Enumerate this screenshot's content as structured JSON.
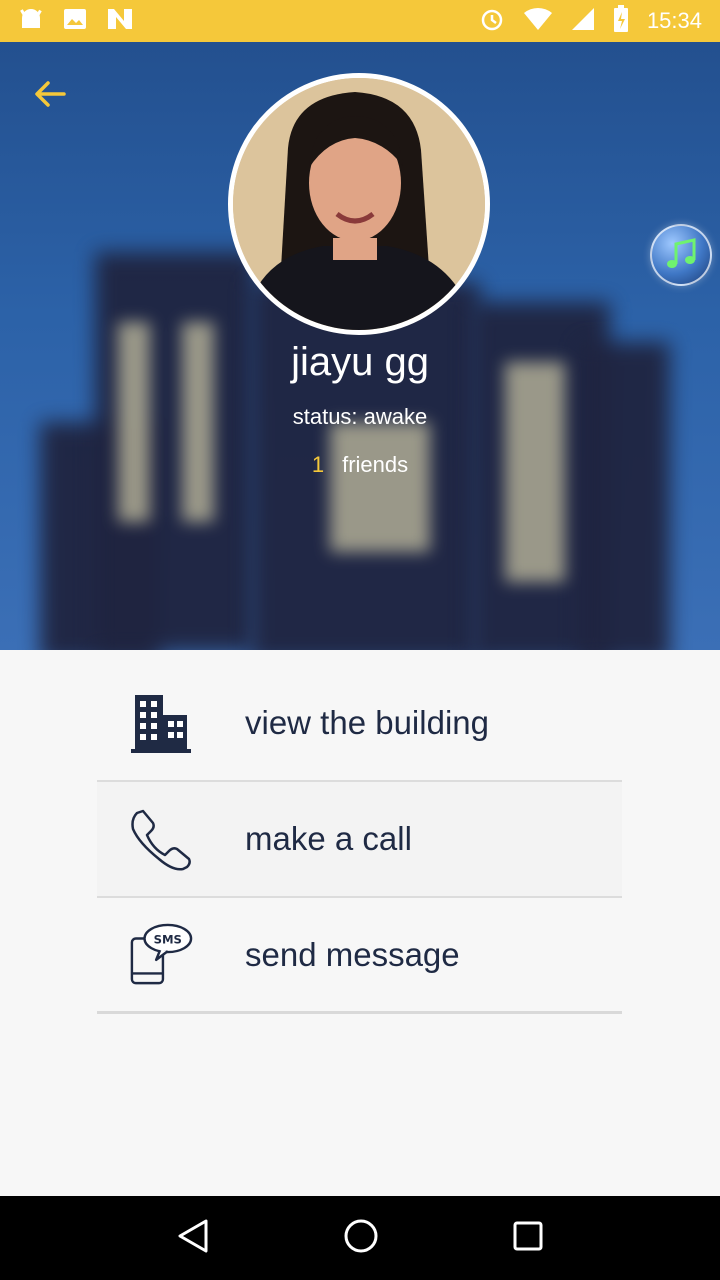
{
  "status_bar": {
    "time": "15:34",
    "left_icons": [
      "android-icon",
      "image-icon",
      "n-icon"
    ],
    "right_icons": [
      "alarm-icon",
      "wifi-icon",
      "signal-icon",
      "battery-icon"
    ],
    "background": "#f5c83a"
  },
  "profile": {
    "name": "jiayu gg",
    "status_label": "status:",
    "status_value": "awake",
    "friends_count": "1",
    "friends_label": "friends"
  },
  "menu": {
    "items": [
      {
        "label": "view the building",
        "icon": "building-icon"
      },
      {
        "label": "make a call",
        "icon": "phone-icon"
      },
      {
        "label": "send message",
        "icon": "sms-icon"
      }
    ],
    "sms_icon_text": "SMS"
  },
  "colors": {
    "accent": "#f5c83a",
    "text_dark": "#1f2a44",
    "hero_blue": "#2c62a8"
  },
  "nav": {
    "buttons": [
      "back-icon",
      "home-icon",
      "recents-icon"
    ]
  }
}
